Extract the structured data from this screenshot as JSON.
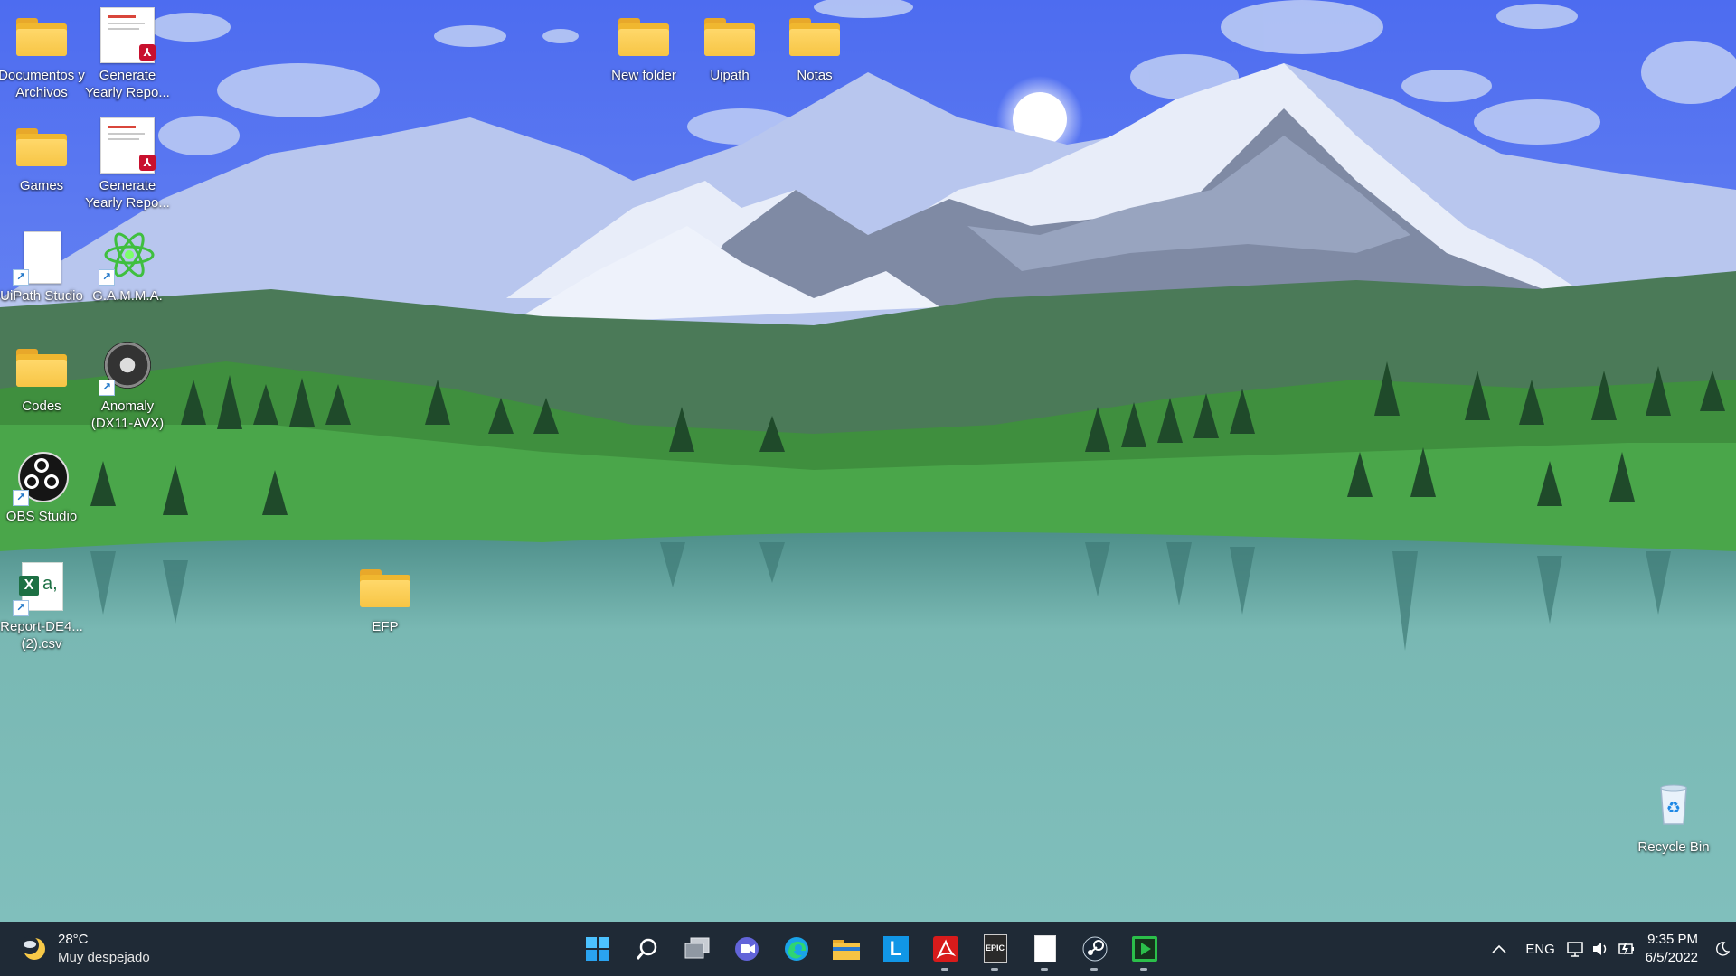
{
  "desktop": {
    "icons": {
      "documentos": "Documentos y Archivos",
      "report1": "Generate Yearly Repo...",
      "new_folder": "New folder",
      "uipath": "Uipath",
      "notas": "Notas",
      "games": "Games",
      "report2": "Generate Yearly Repo...",
      "uipath_studio": "UiPath Studio",
      "gamma": "G.A.M.M.A.",
      "codes": "Codes",
      "anomaly": "Anomaly (DX11-AVX)",
      "obs": "OBS Studio",
      "csv": "Report-DE4... (2).csv",
      "efp": "EFP",
      "recycle": "Recycle Bin"
    }
  },
  "taskbar": {
    "weather": {
      "temp": "28°C",
      "desc": "Muy despejado"
    },
    "apps": [
      "start-icon",
      "search-icon",
      "task-view-icon",
      "chat-icon",
      "edge-icon",
      "file-explorer-icon",
      "l-app-icon",
      "acrobat-icon",
      "epic-games-icon",
      "notepad-icon",
      "steam-icon",
      "media-player-icon"
    ],
    "badges": {
      "epic": "EPIC",
      "l": "L"
    },
    "tray": {
      "language": "ENG",
      "time": "9:35 PM",
      "date": "6/5/2022"
    }
  },
  "colors": {
    "taskbar_bg": "#1f2a36",
    "sky": "#5b78f0",
    "water": "#84c2bf"
  }
}
